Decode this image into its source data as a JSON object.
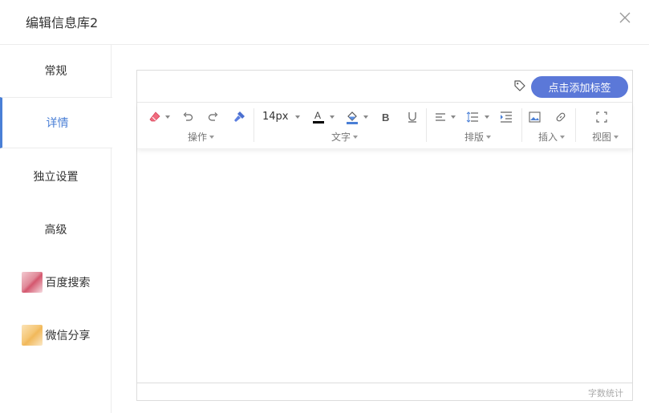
{
  "dialog": {
    "title": "编辑信息库2"
  },
  "sidebar": {
    "items": [
      {
        "label": "常规",
        "active": false
      },
      {
        "label": "详情",
        "active": true
      },
      {
        "label": "独立设置",
        "active": false
      },
      {
        "label": "高级",
        "active": false
      },
      {
        "label": "百度搜索",
        "active": false,
        "icon": "baidu-thumbnail"
      },
      {
        "label": "微信分享",
        "active": false,
        "icon": "wechat-thumbnail"
      }
    ]
  },
  "editor": {
    "add_tag_label": "点击添加标签",
    "font_size": "14px",
    "groups": {
      "operation": "操作",
      "text": "文字",
      "layout": "排版",
      "insert": "插入",
      "view": "视图"
    },
    "word_count_label": "字数统计"
  },
  "colors": {
    "accent": "#4a7fd6",
    "button": "#5b78d8"
  }
}
